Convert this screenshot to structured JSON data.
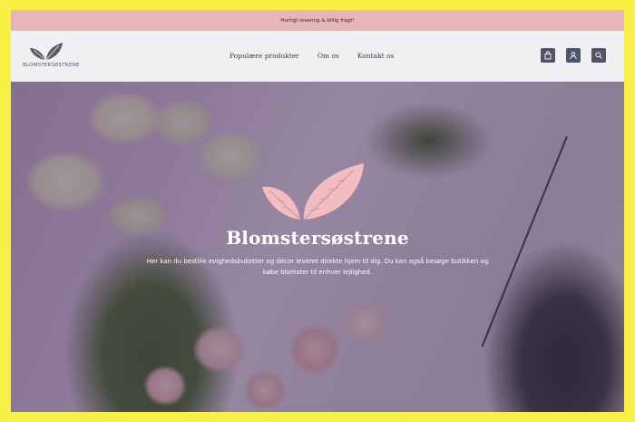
{
  "announcement": "Hurtigt levering & billig fragt!",
  "brand": {
    "name": "BLOMSTERSØSTRENE",
    "logo_icon": "leaves-logo-icon",
    "accent_color": "#e6b5b8"
  },
  "nav": {
    "items": [
      "Populære produkter",
      "Om os",
      "Kontakt os"
    ]
  },
  "header_icons": [
    "bag-icon",
    "user-icon",
    "search-icon"
  ],
  "hero": {
    "title": "Blomstersøstrene",
    "description": "Her kan du bestille evighedsbuketter og décor leveret direkte hjem til dig. Du kan også besøge butikken og købe blomster til enhver lejlighed.",
    "icon": "leaves-icon"
  }
}
